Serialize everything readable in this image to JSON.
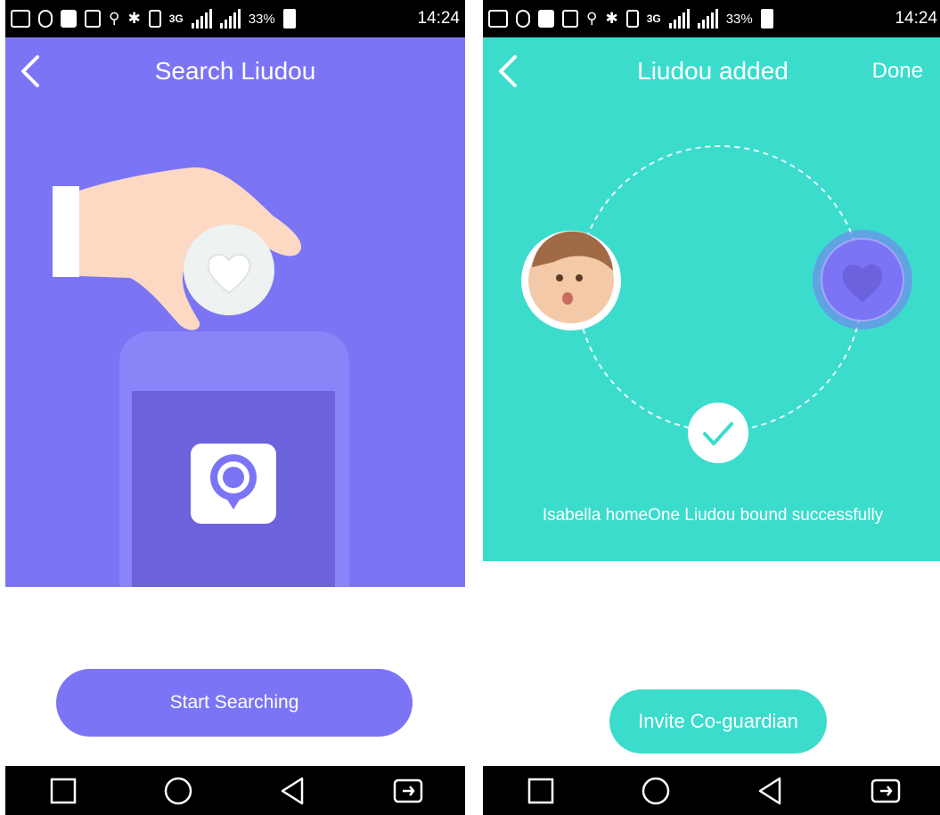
{
  "status_bar": {
    "battery": "33%",
    "time": "14:24",
    "sim_badge": "3G",
    "signal_1": "36",
    "signal_2": "26"
  },
  "search_screen": {
    "title": "Search Liudou",
    "illustration": {
      "hand": "hand-icon",
      "device": "heart-device-icon",
      "phone": "phone-icon",
      "app": "app-logo-icon"
    },
    "start_button": "Start Searching"
  },
  "added_screen": {
    "title": "Liudou added",
    "done": "Done",
    "message": "Isabella homeOne Liudou bound successfully",
    "invite_button": "Invite Co-guardian",
    "icons": {
      "child": "child-avatar",
      "device": "heart-device-icon",
      "status": "check-icon"
    }
  },
  "colors": {
    "purple": "#7b75f5",
    "teal": "#3cdccd",
    "dark_purple": "#6c62dc"
  },
  "nav": [
    "square-icon",
    "circle-icon",
    "triangle-icon",
    "switch-icon"
  ]
}
